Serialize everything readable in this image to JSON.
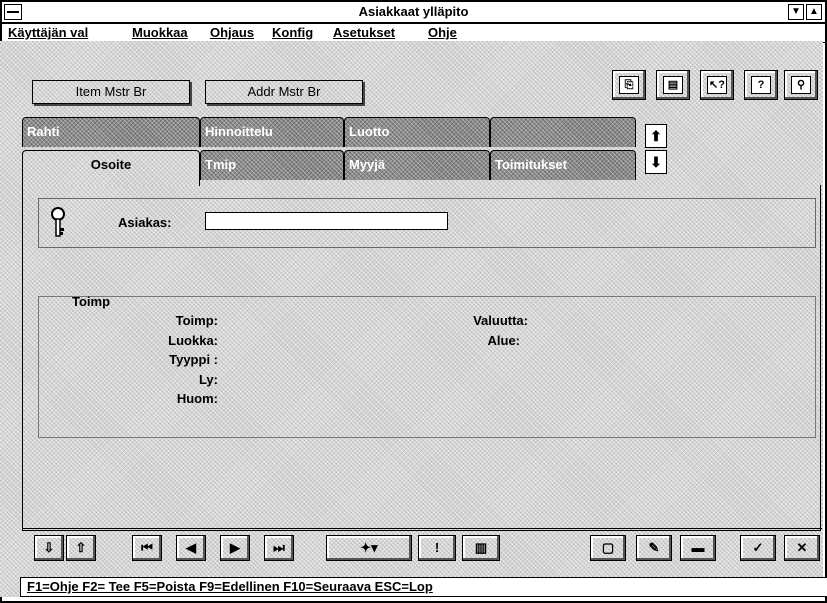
{
  "window": {
    "title": "Asiakkaat ylläpito"
  },
  "menubar": {
    "items": [
      {
        "label": "Käyttäjän val"
      },
      {
        "label": "Muokkaa"
      },
      {
        "label": "Ohjaus"
      },
      {
        "label": "Konfig"
      },
      {
        "label": "Asetukset"
      },
      {
        "label": "Ohje"
      }
    ]
  },
  "toolbar": {
    "item_mstr_br": "Item Mstr Br",
    "addr_mstr_br": "Addr Mstr Br",
    "icons": [
      "copy-icon",
      "paste-icon",
      "help-pointer-icon",
      "help-book-icon",
      "search-key-icon"
    ]
  },
  "tabs": {
    "row1": [
      "Rahti",
      "Hinnoittelu",
      "Luotto",
      ""
    ],
    "row2": [
      "Osoite",
      "Tmip",
      "Myyjä",
      "Toimitukset"
    ],
    "active": "Osoite"
  },
  "form": {
    "asiakas_label": "Asiakas:",
    "asiakas_value": "",
    "group_title": "Toimp",
    "fields_left": [
      "Toimp:",
      "Luokka:",
      "Tyyppi :",
      "Ly:",
      "Huom:"
    ],
    "fields_right": [
      "Valuutta:",
      "Alue:"
    ]
  },
  "status": {
    "text": "F1=Ohje  F2= Tee  F5=Poista  F9=Edellinen  F10=Seuraava  ESC=Lop"
  }
}
